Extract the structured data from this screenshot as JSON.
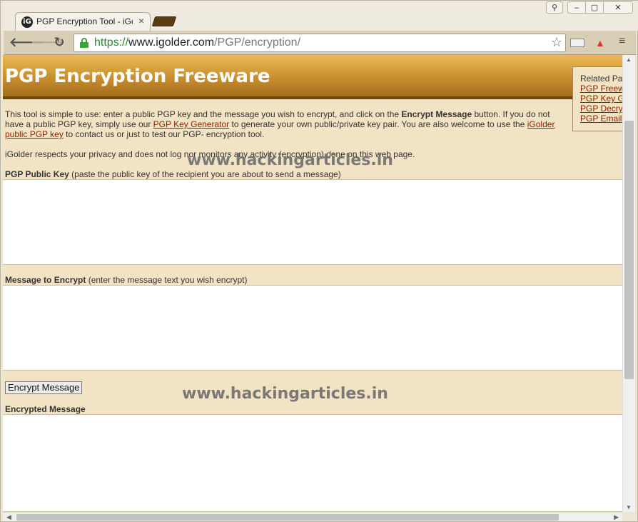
{
  "browser": {
    "tab_title": "PGP Encryption Tool - iGolder",
    "tab_favicon": "iG",
    "tab_close": "×",
    "url_scheme": "https://",
    "url_host": "www.igolder.com",
    "url_path": "/PGP/encryption/",
    "back_glyph": "🡐",
    "forward_glyph": "🡒",
    "reload_glyph": "↻",
    "star_glyph": "☆",
    "menu_glyph": "≡",
    "win_user": "⚲",
    "win_min": "–",
    "win_max": "▢",
    "win_close": "✕",
    "icons": [
      "back-icon",
      "forward-icon",
      "reload-icon",
      "lock-icon",
      "star-icon",
      "extension-icon",
      "menu-icon"
    ]
  },
  "page": {
    "banner_title": "PGP Encryption Freeware",
    "related": {
      "title": "Related Pa",
      "links": [
        "PGP Freew",
        "PGP Key G",
        "PGP Decry",
        "PGP Email"
      ]
    },
    "intro": {
      "t1": "This tool is simple to use: enter a public PGP key and the message you wish to encrypt, and click on the ",
      "b1": "Encrypt Message",
      "t2": " button.  If you do not have a public PGP key, simply use our ",
      "link1": "PGP Key Generator",
      "t3": " to generate your own public/private key pair.  You are also welcome to use the ",
      "link2": "iGolder public PGP key",
      "t4": " to contact us or just to test our PGP- encryption tool."
    },
    "privacy": "iGolder respects your privacy and does not log nor monitors any activity (encryption) done on this web page.",
    "key_label_bold": "PGP Public Key",
    "key_label_rest": " (paste the public key of the recipient you are about to send a message)",
    "msg_label_bold": "Message to Encrypt",
    "msg_label_rest": " (enter the message text you wish encrypt)",
    "encrypt_button": "Encrypt Message",
    "encrypted_label": "Encrypted Message",
    "public_key_value": "",
    "message_value": "",
    "encrypted_value": ""
  },
  "watermark": "www.hackingarticles.in",
  "colors": {
    "banner_top": "#ecba55",
    "banner_bottom": "#a26d1e",
    "page_bg": "#f3e3c5",
    "link": "#8b2500"
  }
}
